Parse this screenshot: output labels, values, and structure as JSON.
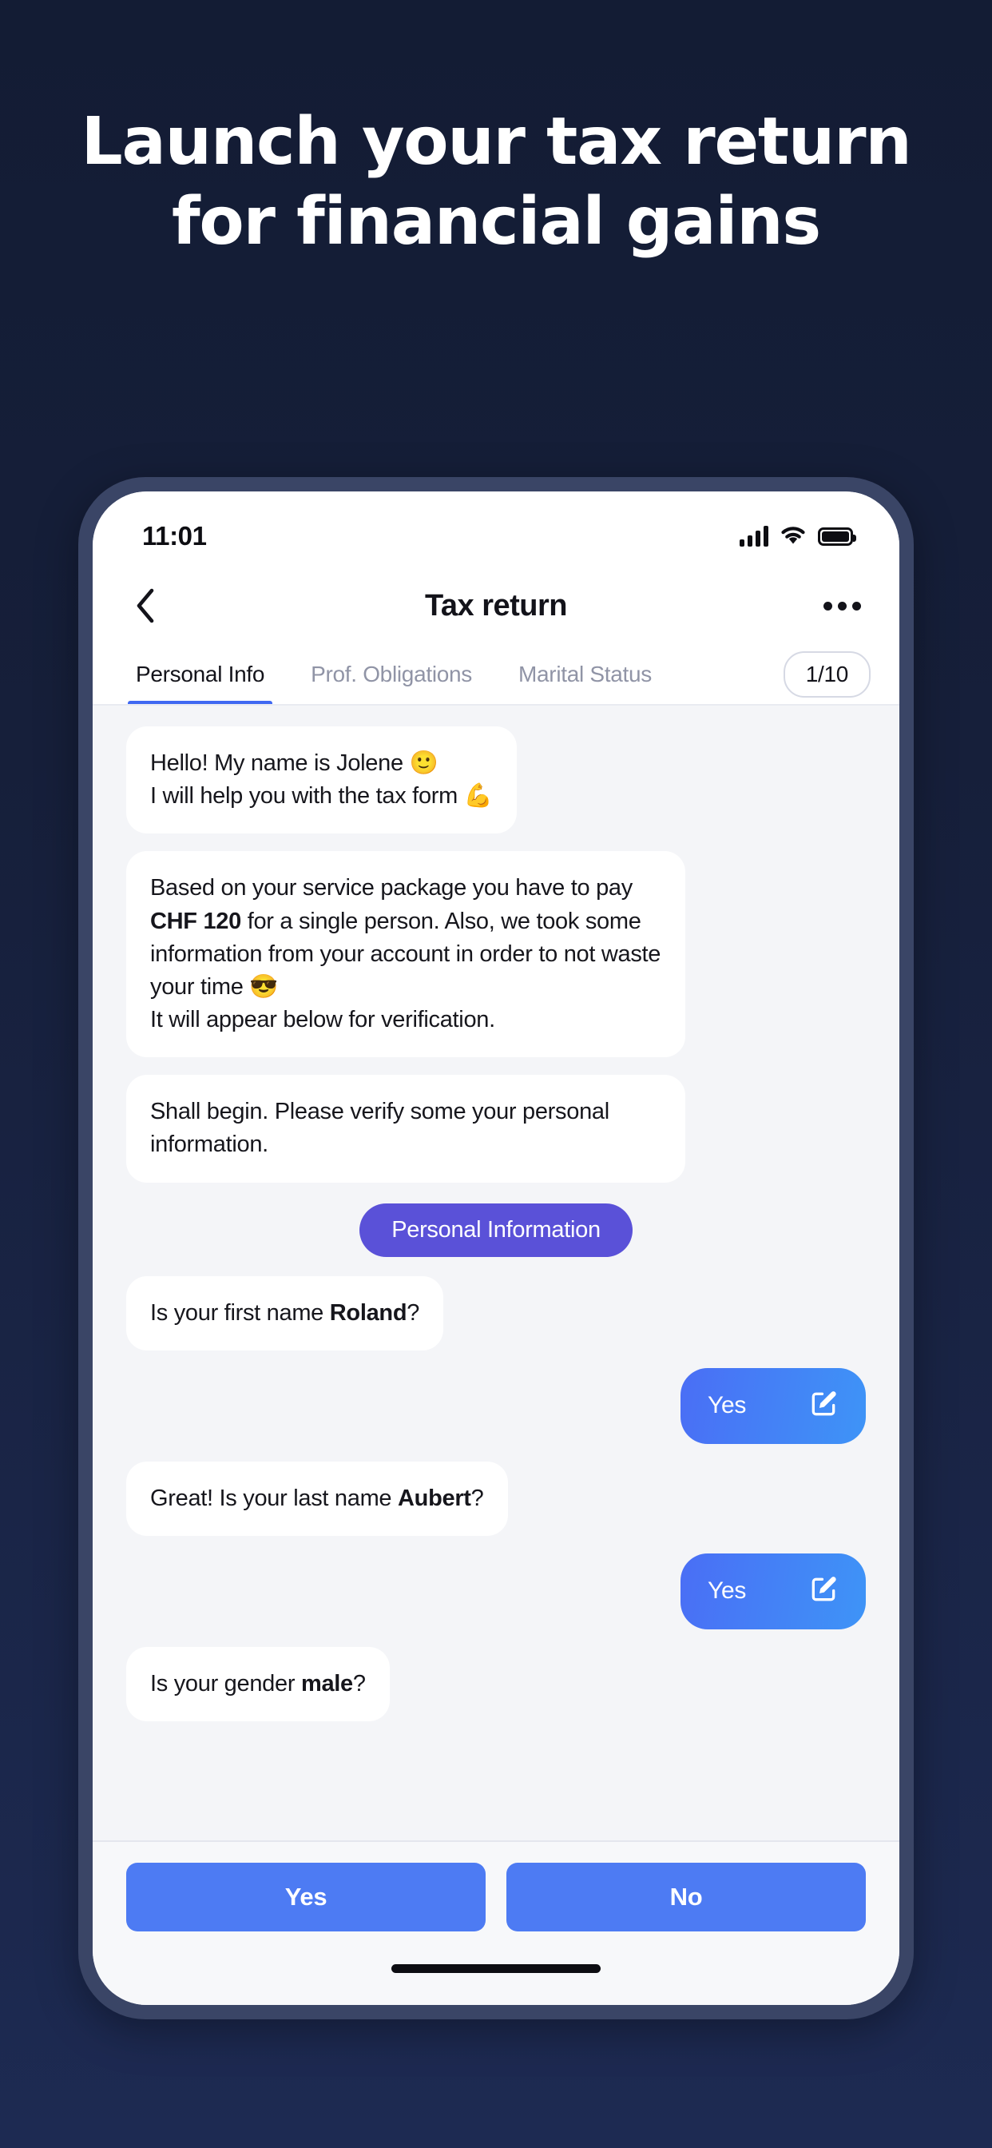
{
  "promo": {
    "headline": "Launch your tax return for financial gains",
    "background_color": "#131c34"
  },
  "phone": {
    "status_bar": {
      "time": "11:01",
      "icons": [
        "signal-icon",
        "wifi-icon",
        "battery-icon"
      ]
    },
    "header": {
      "back_icon": "chevron-left-icon",
      "title": "Tax return",
      "more_icon": "more-horizontal-icon"
    },
    "tabs": {
      "items": [
        {
          "label": "Personal Info",
          "active": true
        },
        {
          "label": "Prof. Obligations",
          "active": false
        },
        {
          "label": "Marital Status",
          "active": false
        }
      ],
      "counter": "1/10",
      "active_underline_color": "#3f68f2"
    },
    "chat": {
      "messages": [
        {
          "type": "bot",
          "line1": "Hello! My name is Jolene 🙂",
          "line2": "I will help you with the tax form 💪"
        },
        {
          "type": "bot",
          "pre": "Based on your service package you have to pay ",
          "strong": "CHF 120",
          "post": " for a single person. Also, we took some information from your account in order to not waste your time 😎",
          "line2": "It will appear below for verification."
        },
        {
          "type": "bot",
          "text": "Shall begin. Please verify some your personal information."
        },
        {
          "type": "section-pill",
          "label": "Personal Information",
          "color": "#5a51d8"
        },
        {
          "type": "bot-inline",
          "pre": "Is your first name ",
          "strong": "Roland",
          "post": "?"
        },
        {
          "type": "user-reply",
          "label": "Yes",
          "icon": "edit-pencil-icon"
        },
        {
          "type": "bot-inline",
          "pre": "Great! Is your last name ",
          "strong": "Aubert",
          "post": "?"
        },
        {
          "type": "user-reply",
          "label": "Yes",
          "icon": "edit-pencil-icon"
        },
        {
          "type": "bot-inline",
          "pre": "Is your gender ",
          "strong": "male",
          "post": "?"
        }
      ]
    },
    "actions": {
      "yes_label": "Yes",
      "no_label": "No",
      "button_color": "#4d7bf3"
    }
  }
}
